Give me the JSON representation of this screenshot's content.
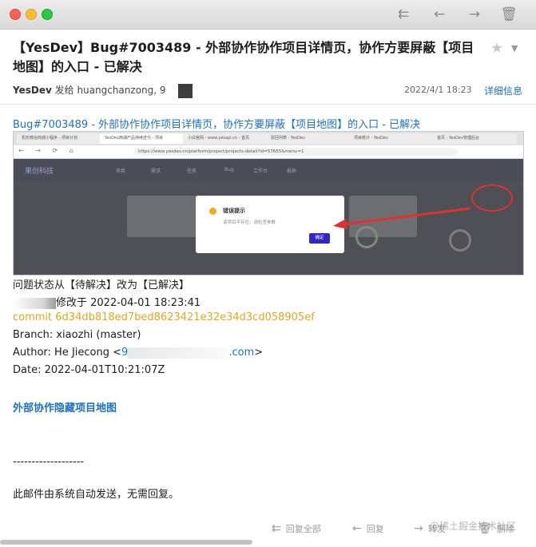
{
  "window": {
    "toolbar_icons": [
      "reply-all-icon",
      "reply-icon",
      "forward-icon",
      "trash-icon"
    ]
  },
  "header": {
    "subject": "【YesDev】Bug#7003489 - 外部协作协作项目详情页，协作方要屏蔽【项目地图】的入口 - 已解决",
    "sender": "YesDev",
    "sent_to": "发给 huangchanzong, 9",
    "date": "2022/4/1  18:23",
    "details_link": "详细信息"
  },
  "body": {
    "title_link": "Bug#7003489 - 外部协作协作项目详情页，协作方要屏蔽【项目地图】的入口 - 已解决",
    "screenshot": {
      "tabs": [
        "机形微信商城小程序 - 项目计划",
        "YesDev西湖产品持续迭代 - 项目",
        "小白官网 - www.yesapi.cn - 首页",
        "驳回列表 - YesDev",
        "项目统计 - YesDev",
        "首页 - YesDev管理后台"
      ],
      "url": "https://www.yesdev.cn/platform/project/projects-detail?id=57655&menu=1",
      "app_logo": "果创科技",
      "menu": [
        "项目",
        "需求",
        "任务",
        "Bug",
        "工作台",
        "报表"
      ],
      "modal_title": "错误提示",
      "modal_message": "该项目不存在，请检查参数",
      "modal_button": "确定"
    },
    "status_change": "问题状态从【待解决】改为【已解决】",
    "modified_at": "修改于 2022-04-01 18:23:41",
    "commit": "commit 6d34db818ed7bed8623421e32e34d3cd058905ef",
    "branch": "Branch: xiaozhi (master)",
    "author_prefix": "Author: He Jiecong <",
    "author_email_start": "9",
    "author_email_end": ".com",
    "author_suffix": ">",
    "commit_date": "Date: 2022-04-01T10:21:07Z",
    "commit_message": "外部协作隐藏项目地图",
    "divider": "-------------------",
    "footer_note": "此邮件由系统自动发送，无需回复。"
  },
  "bottom_toolbar": {
    "reply_all": "回复全部",
    "reply": "回复",
    "forward": "转发",
    "delete": "删除"
  },
  "watermark": "@稀土掘金技术社区"
}
